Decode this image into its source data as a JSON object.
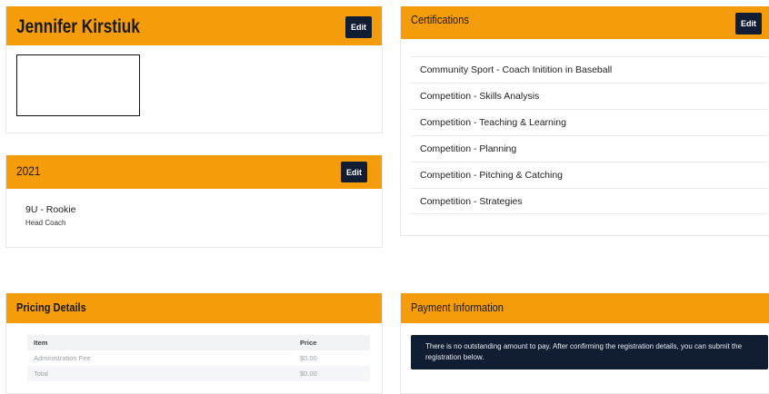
{
  "profile": {
    "name": "Jennifer Kirstiuk",
    "edit_label": "Edit"
  },
  "season": {
    "year": "2021",
    "edit_label": "Edit",
    "team": "9U - Rookie",
    "role": "Head Coach"
  },
  "certifications": {
    "title": "Certifications",
    "edit_label": "Edit",
    "items": [
      "Community Sport - Coach Initition in Baseball",
      "Competition - Skills Analysis",
      "Competition - Teaching & Learning",
      "Competition - Planning",
      "Competition - Pitching & Catching",
      "Competition - Strategies"
    ]
  },
  "pricing": {
    "title": "Pricing Details",
    "headers": {
      "item": "Item",
      "price": "Price"
    },
    "rows": [
      {
        "item": "Administration Fee",
        "price": "$0.00"
      },
      {
        "item": "Total",
        "price": "$0.00"
      }
    ]
  },
  "payment": {
    "title": "Payment Information",
    "message": "There is no outstanding amount to pay. After confirming the registration details, you can submit the registration below."
  },
  "colors": {
    "header_orange": "#f59c0b",
    "navy": "#101d33"
  }
}
